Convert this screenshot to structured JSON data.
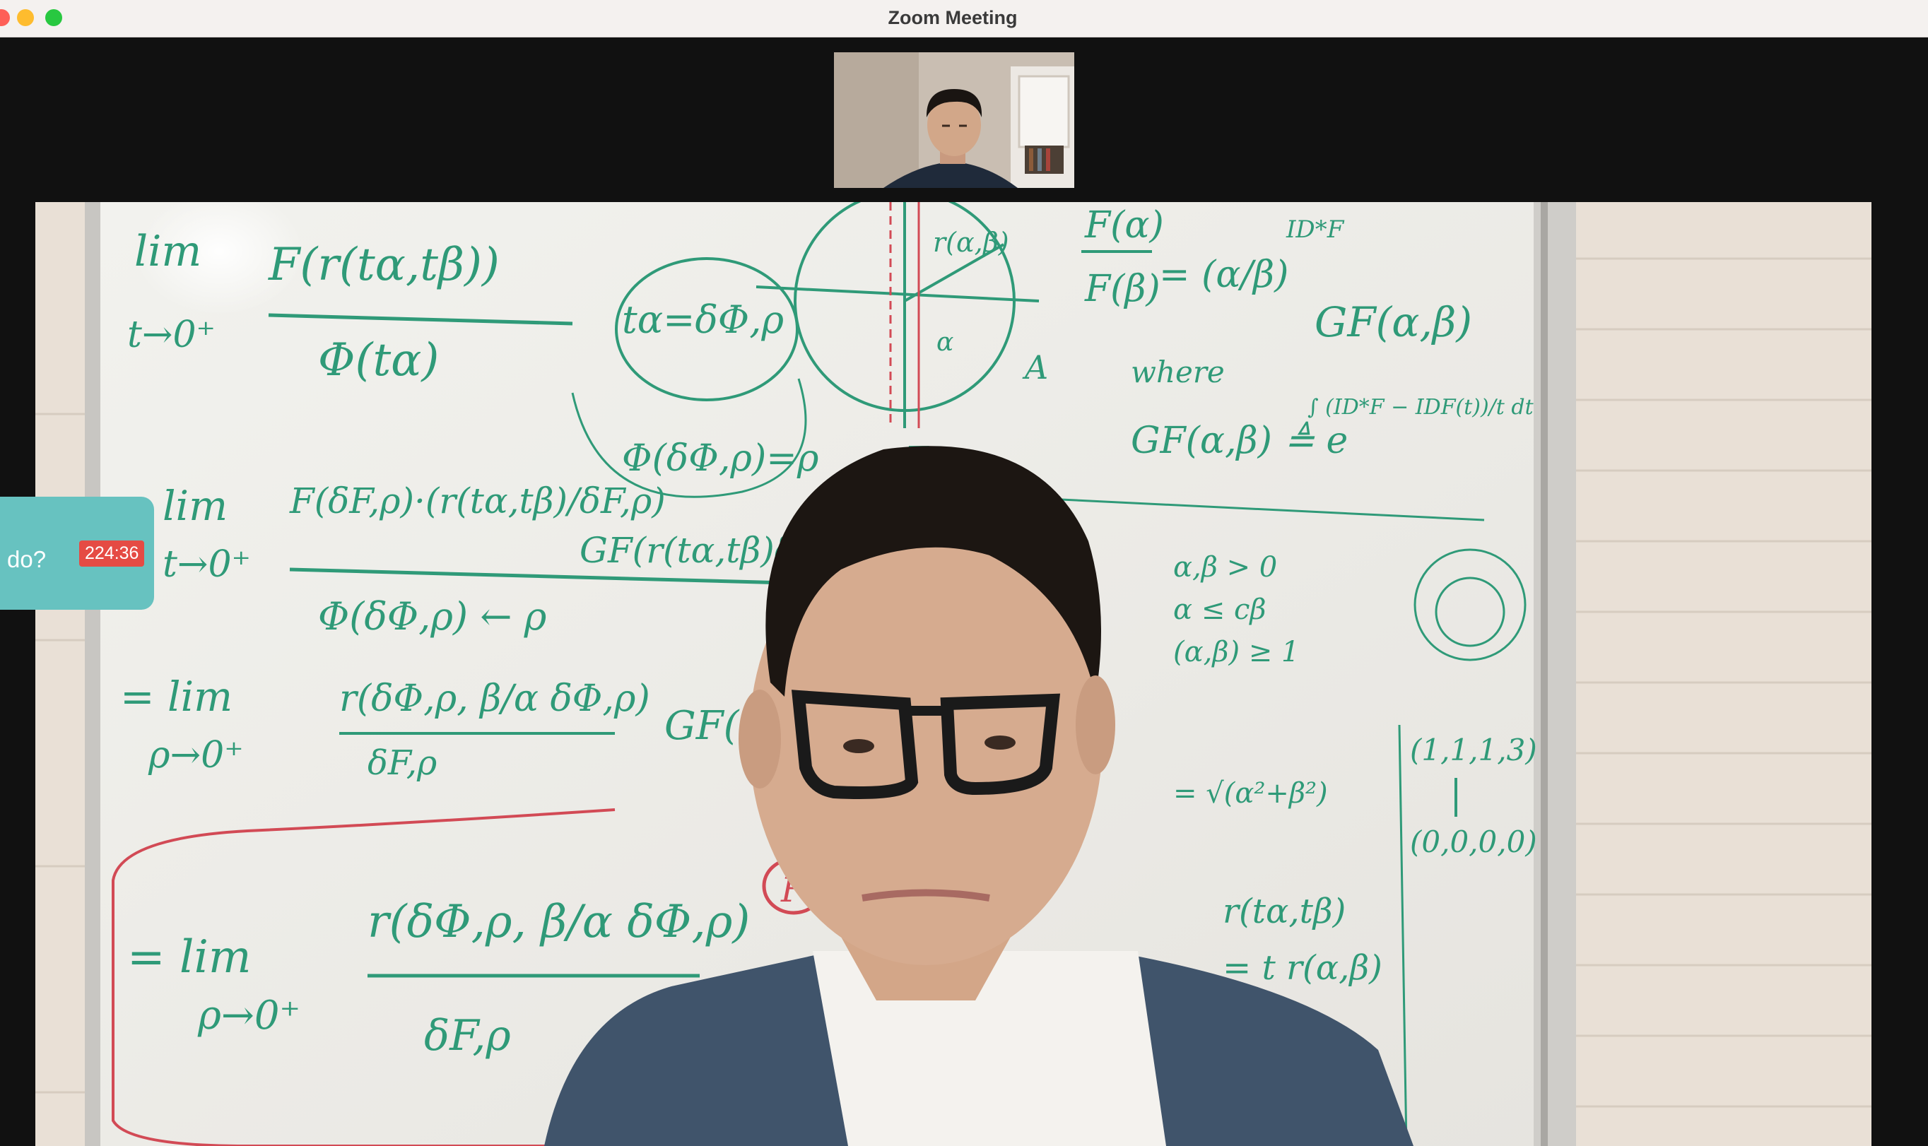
{
  "window": {
    "title": "Zoom Meeting"
  },
  "timer_widget": {
    "text": "do?",
    "badge": "224:36"
  },
  "colors": {
    "titlebar": "#f4f1ef",
    "background": "#111111",
    "accent_teal": "#67c2c0",
    "badge_red": "#e54b44",
    "marker_green": "#2f9a78",
    "marker_red": "#d24a55"
  },
  "whiteboard_text": {
    "limit_1": "lim",
    "limit_1_var": "t→0⁺",
    "frac_1_num": "F(r(tα,tβ))",
    "frac_1_den": "Φ(tα)",
    "circle_1": "tα=δΦ,ρ",
    "circle_2": "Φ(δΦ,ρ)=ρ",
    "ratio_num": "F(α)",
    "ratio_den": "F(β)",
    "ratio_rhs": "= (α/β)",
    "ratio_exp": "ID*F",
    "g_func": "GF(α,β)",
    "where": "where",
    "g_def": "GF(α,β) ≜ e",
    "g_def_exp": "∫ (ID*F − IDF(t))/t dt",
    "limit_2": "lim",
    "limit_2_var": "t→0⁺",
    "expr_2_num": "F(δF,ρ)·(r(tα,tβ)/δF,ρ)",
    "expr_2_den": "Φ(δΦ,ρ) ← ρ",
    "expr_2_rhs": "GF(r(tα,tβ)δF,ρ)",
    "limit_3": "= lim",
    "limit_3_var": "ρ→0⁺",
    "expr_3_num": "r(δΦ,ρ, β/α δΦ,ρ)",
    "expr_3_den": "δF,ρ",
    "expr_3_rhs": "GF(r(δ",
    "limit_4": "= lim",
    "limit_4_var": "ρ→0⁺",
    "expr_4_num": "r(δΦ,ρ, β/α δΦ,ρ)",
    "expr_4_den": "δF,ρ",
    "boxed_f": "F",
    "right_1": "α,β > 0",
    "right_2": "α ≤ cβ",
    "right_3": "(α,β) ≥ 1",
    "right_4": "= √(α²+β²)",
    "right_5": "r(tα,tβ)",
    "right_6": "= t r(α,β)",
    "far_right_1": "(1,1,1,3)",
    "far_right_2": "(0,0,0,0)",
    "diagram_label": "r(α,β)",
    "diagram_alpha": "α",
    "diagram_a": "A",
    "diagram_f": "F"
  }
}
